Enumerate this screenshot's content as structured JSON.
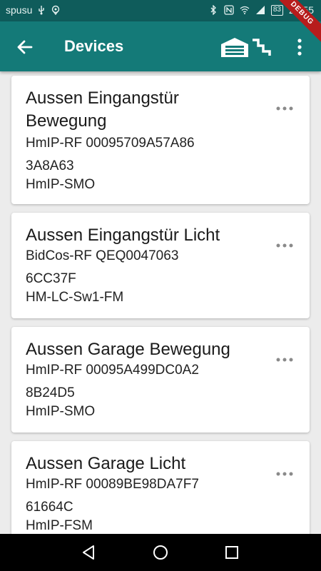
{
  "status_bar": {
    "carrier": "spusu",
    "battery": "83",
    "time": "22:55"
  },
  "debug_banner": "DEBUG",
  "app_bar": {
    "title": "Devices"
  },
  "devices": [
    {
      "name": "Aussen Eingangstür Bewegung",
      "address": "HmIP-RF 00095709A57A86",
      "id": "3A8A63",
      "model": "HmIP-SMO"
    },
    {
      "name": "Aussen Eingangstür Licht",
      "address": "BidCos-RF QEQ0047063",
      "id": "6CC37F",
      "model": "HM-LC-Sw1-FM"
    },
    {
      "name": "Aussen Garage Bewegung",
      "address": "HmIP-RF 00095A499DC0A2",
      "id": "8B24D5",
      "model": "HmIP-SMO"
    },
    {
      "name": "Aussen Garage Licht",
      "address": "HmIP-RF 00089BE98DA7F7",
      "id": "61664C",
      "model": "HmIP-FSM"
    }
  ],
  "icons": {
    "back": "arrow-back-icon",
    "garage": "garage-icon",
    "stairs": "stairs-icon",
    "more": "more-vert-icon",
    "card_more": "more-horiz-icon"
  }
}
